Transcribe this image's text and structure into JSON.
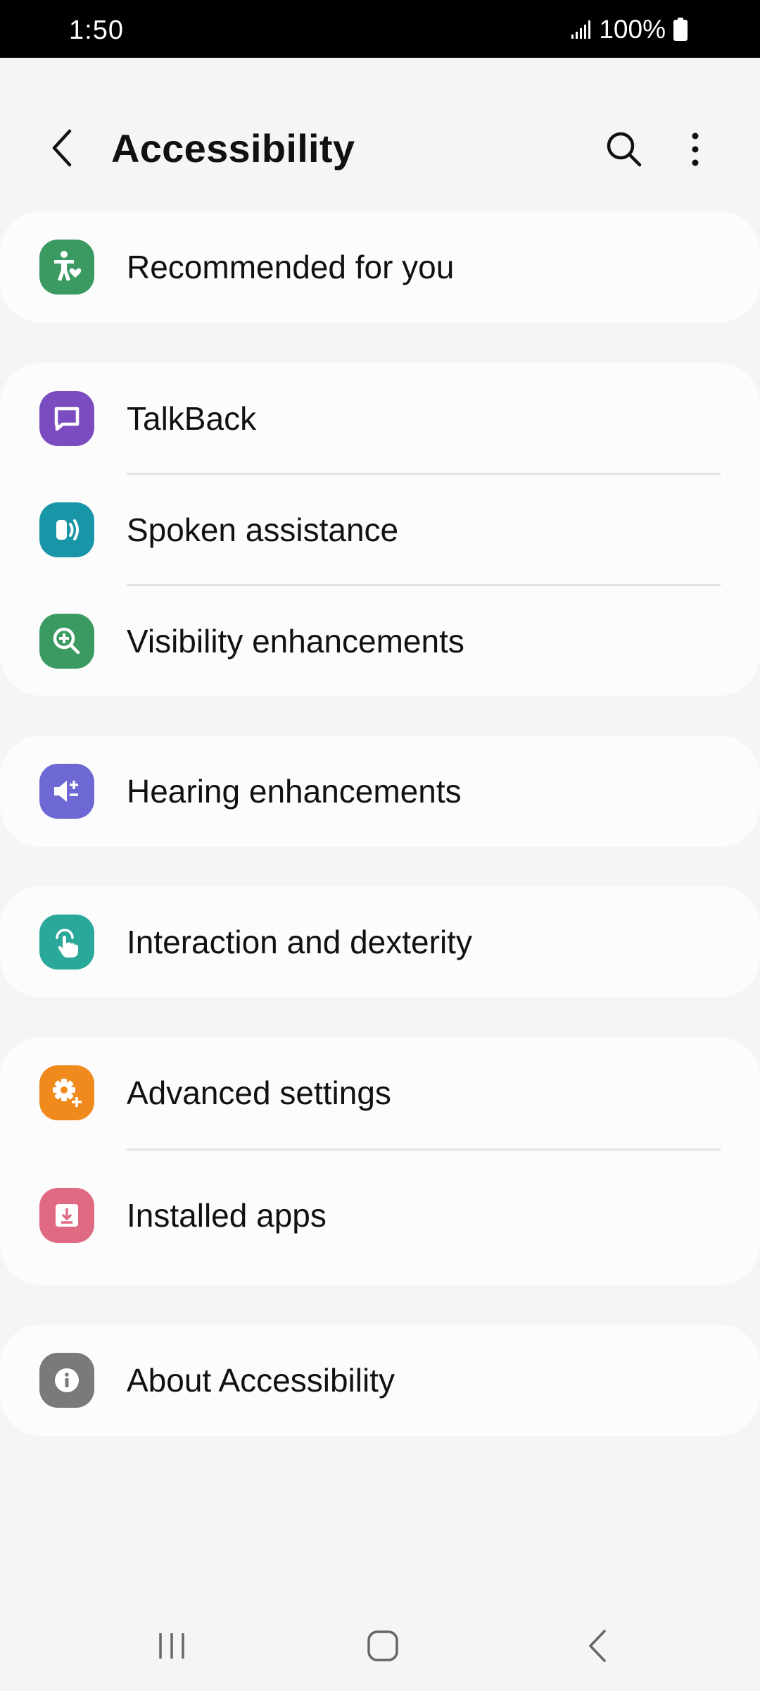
{
  "status_bar": {
    "time": "1:50",
    "battery_text": "100%",
    "icons": [
      "signal-icon",
      "battery-icon"
    ]
  },
  "header": {
    "title": "Accessibility",
    "actions": [
      "back-icon",
      "search-icon",
      "more-options-icon"
    ]
  },
  "sections": [
    {
      "items": [
        {
          "label": "Recommended for you",
          "icon": "accessibility-heart-icon",
          "color": "#3a9a62"
        }
      ]
    },
    {
      "items": [
        {
          "label": "TalkBack",
          "icon": "chat-bubble-icon",
          "color": "#7a4cc0"
        },
        {
          "label": "Spoken assistance",
          "icon": "speaker-voice-icon",
          "color": "#1995a8"
        },
        {
          "label": "Visibility enhancements",
          "icon": "zoom-in-icon",
          "color": "#3a9a62"
        }
      ]
    },
    {
      "items": [
        {
          "label": "Hearing enhancements",
          "icon": "volume-plus-minus-icon",
          "color": "#6d68d4"
        }
      ]
    },
    {
      "items": [
        {
          "label": "Interaction and dexterity",
          "icon": "touch-hand-icon",
          "color": "#2aa89a"
        }
      ]
    },
    {
      "items": [
        {
          "label": "Advanced settings",
          "icon": "gear-plus-icon",
          "color": "#f08a1c"
        },
        {
          "label": "Installed apps",
          "icon": "download-tray-icon",
          "color": "#e06a82"
        }
      ]
    },
    {
      "items": [
        {
          "label": "About Accessibility",
          "icon": "info-icon",
          "color": "#7a7a7a"
        }
      ]
    }
  ],
  "nav_bar": {
    "buttons": [
      "recents-icon",
      "home-icon",
      "back-nav-icon"
    ]
  }
}
